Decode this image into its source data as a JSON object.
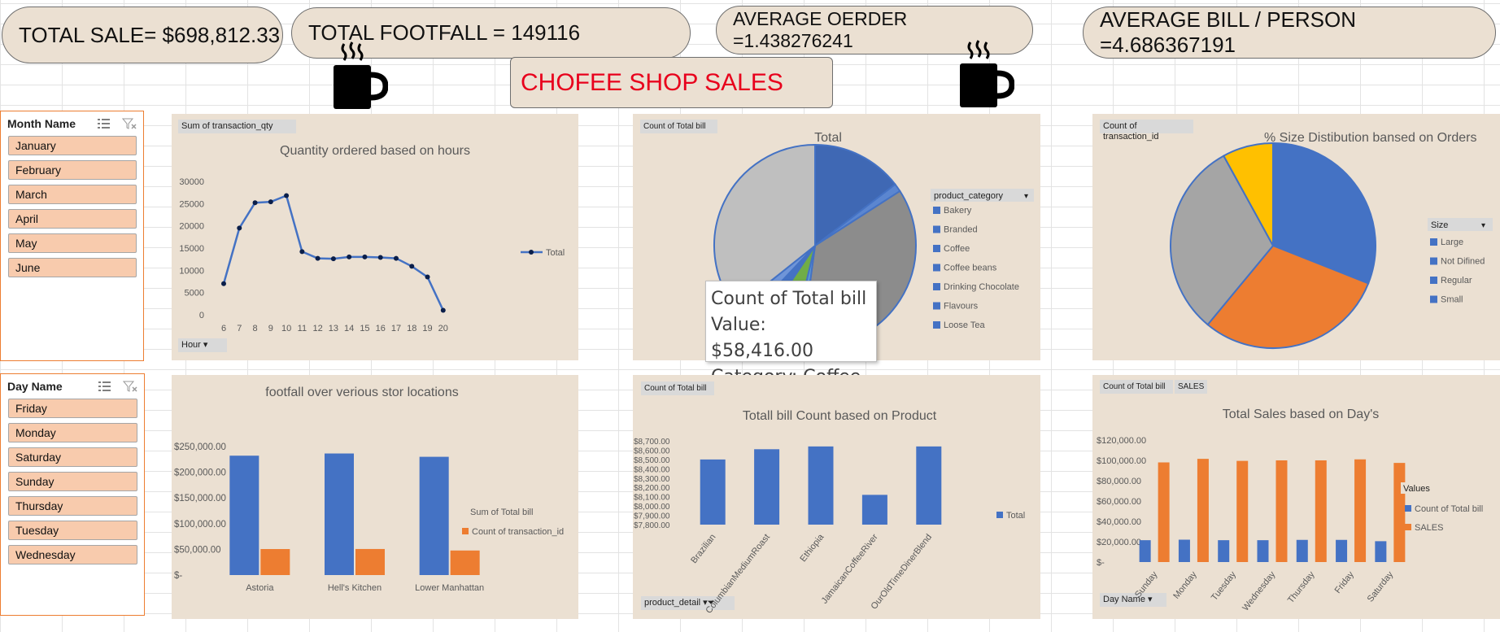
{
  "kpis": {
    "total_sale": "TOTAL SALE= $698,812.33",
    "total_footfall": "TOTAL FOOTFALL = 149116",
    "average_order": "AVERAGE OERDER =1.438276241",
    "average_bill": "AVERAGE BILL / PERSON =4.686367191"
  },
  "dashboard_title": "CHOFEE SHOP SALES",
  "slicers": {
    "month": {
      "title": "Month Name",
      "items": [
        "January",
        "February",
        "March",
        "April",
        "May",
        "June"
      ]
    },
    "day": {
      "title": "Day Name",
      "items": [
        "Friday",
        "Monday",
        "Saturday",
        "Sunday",
        "Thursday",
        "Tuesday",
        "Wednesday"
      ]
    }
  },
  "tags": {
    "hours_field": "Sum of transaction_qty",
    "hours_axis_field": "Hour",
    "pie1_field": "Count of Total bill",
    "pie2_field": "Count of transaction_id",
    "loc_field": "Count of Total bill",
    "prod_field": "Count of Total bill",
    "prod_axis_field": "product_detail",
    "day_field1": "Count of Total bill",
    "day_field2": "SALES",
    "day_axis_field": "Day Name"
  },
  "tooltip": {
    "line1": "Count of Total bill",
    "line2": "Value:  $58,416.00",
    "line3": "Category: Coffee"
  },
  "colors": {
    "panel": "#ebe0d2",
    "blue": "#4472c4",
    "orange": "#ed7d31",
    "gray": "#a5a5a5",
    "yellow": "#ffc000",
    "accent_red": "#e8001c",
    "slicer_item": "#f8cbad"
  },
  "chart_data": [
    {
      "id": "hours",
      "type": "line",
      "title": "Quantity ordered based on hours",
      "xlabel": "",
      "ylabel": "",
      "x": [
        6,
        7,
        8,
        9,
        10,
        11,
        12,
        13,
        14,
        15,
        16,
        17,
        18,
        19,
        20
      ],
      "series": [
        {
          "name": "Total",
          "values": [
            7000,
            19500,
            25200,
            25400,
            26800,
            14200,
            12700,
            12600,
            13000,
            13000,
            12900,
            12700,
            10900,
            8500,
            1000
          ]
        }
      ],
      "yticks": [
        "30000",
        "25000",
        "20000",
        "15000",
        "10000",
        "5000",
        "0"
      ],
      "ylim": [
        0,
        30000
      ]
    },
    {
      "id": "category_pie",
      "type": "pie",
      "title": "Total",
      "legend_title": "product_category",
      "categories": [
        "Bakery",
        "Branded",
        "Coffee",
        "Coffee beans",
        "Drinking Chocolate",
        "Flavours",
        "Loose Tea"
      ],
      "values": [
        13.5,
        1.2,
        33.5,
        1.5,
        5.2,
        2.4,
        2.1
      ],
      "extra_slice": {
        "category": "(other)",
        "value": 33.0
      }
    },
    {
      "id": "size_pie",
      "type": "pie",
      "title": "% Size Distibution bansed on Orders",
      "legend_title": "Size",
      "categories": [
        "Large",
        "Not Difined",
        "Regular",
        "Small"
      ],
      "values": [
        31,
        30,
        31,
        8
      ]
    },
    {
      "id": "locations",
      "type": "bar",
      "title": "footfall over verious stor locations",
      "categories": [
        "Astoria",
        "Hell's Kitchen",
        "Lower Manhattan"
      ],
      "series": [
        {
          "name": "Sum of Total bill",
          "values": [
            232243.91,
            236511.17,
            230057.25
          ]
        },
        {
          "name": "Count of transaction_id",
          "values": [
            50599,
            50735,
            47782
          ]
        }
      ],
      "yticks": [
        "$250,000.00",
        "$200,000.00",
        "$150,000.00",
        "$100,000.00",
        "$50,000.00",
        "$-"
      ],
      "ylim": [
        0,
        250000
      ]
    },
    {
      "id": "products",
      "type": "bar",
      "title": "Totall bill Count based on  Product",
      "categories": [
        "Brazilian",
        "ColumbianMediumRoast",
        "Ethiopia",
        "JamaicanCoffeeRiver",
        "OurOldTimeDinerBlend"
      ],
      "series": [
        {
          "name": "Total",
          "values": [
            8500,
            8610,
            8640,
            8120,
            8640
          ]
        }
      ],
      "yticks": [
        "$8,700.00",
        "$8,600.00",
        "$8,500.00",
        "$8,400.00",
        "$8,300.00",
        "$8,200.00",
        "$8,100.00",
        "$8,000.00",
        "$7,900.00",
        "$7,800.00"
      ],
      "ylim": [
        7800,
        8700
      ]
    },
    {
      "id": "days",
      "type": "bar",
      "title": "Total Sales based on Day's",
      "legend_title": "Values",
      "categories": [
        "Sunday",
        "Monday",
        "Tuesday",
        "Wednesday",
        "Thursday",
        "Friday",
        "Saturday"
      ],
      "series": [
        {
          "name": "Count of Total bill",
          "values": [
            21500,
            22000,
            21500,
            21500,
            21800,
            21800,
            20500
          ]
        },
        {
          "name": "SALES",
          "values": [
            98000,
            101500,
            99500,
            100000,
            100000,
            101000,
            97500
          ]
        }
      ],
      "yticks": [
        "$120,000.00",
        "$100,000.00",
        "$80,000.00",
        "$60,000.00",
        "$40,000.00",
        "$20,000.00",
        "$-"
      ],
      "ylim": [
        0,
        120000
      ]
    }
  ]
}
